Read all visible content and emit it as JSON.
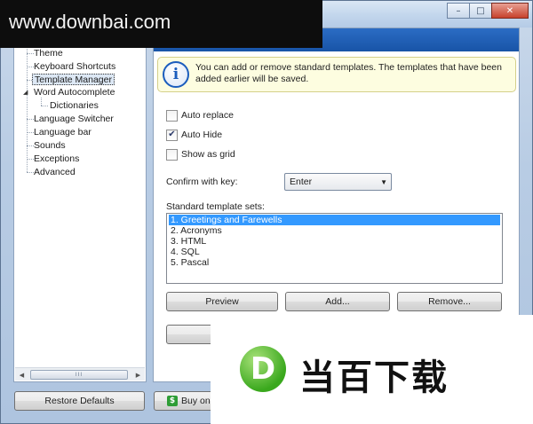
{
  "watermark": {
    "top_text": "www.downbai.com",
    "bottom_logo_letter": "D",
    "bottom_brand": "当百下载"
  },
  "window_controls": {
    "minimize": "–",
    "maximize": "□",
    "close": "✕"
  },
  "tree": {
    "items": [
      {
        "label": "Theme"
      },
      {
        "label": "Keyboard Shortcuts"
      },
      {
        "label": "Template Manager",
        "selected": true
      },
      {
        "label": "Word Autocomplete",
        "expanded": true
      },
      {
        "label": "Dictionaries"
      },
      {
        "label": "Language Switcher"
      },
      {
        "label": "Language bar"
      },
      {
        "label": "Sounds"
      },
      {
        "label": "Exceptions"
      },
      {
        "label": "Advanced"
      }
    ],
    "scroll_grip": "III",
    "scroll_left": "◀",
    "scroll_right": "▶"
  },
  "info": {
    "icon": "i",
    "text": "You can add or remove standard templates. The templates that have been added earlier will be saved."
  },
  "options": {
    "auto_replace": {
      "label": "Auto replace",
      "checked": false
    },
    "auto_hide": {
      "label": "Auto Hide",
      "checked": true,
      "mark": "✔"
    },
    "show_as_grid": {
      "label": "Show as grid",
      "checked": false
    }
  },
  "confirm": {
    "label": "Confirm with key:",
    "value": "Enter",
    "caret": "▼"
  },
  "template_sets": {
    "label": "Standard template sets:",
    "items": [
      {
        "label": "1. Greetings and Farewells",
        "selected": true
      },
      {
        "label": "2. Acronyms"
      },
      {
        "label": "3. HTML"
      },
      {
        "label": "4. SQL"
      },
      {
        "label": "5. Pascal"
      }
    ]
  },
  "buttons": {
    "preview": "Preview",
    "add": "Add...",
    "remove": "Remove..."
  },
  "footer": {
    "restore_defaults": "Restore Defaults",
    "buy_online": "Buy onli",
    "dollar": "$"
  }
}
